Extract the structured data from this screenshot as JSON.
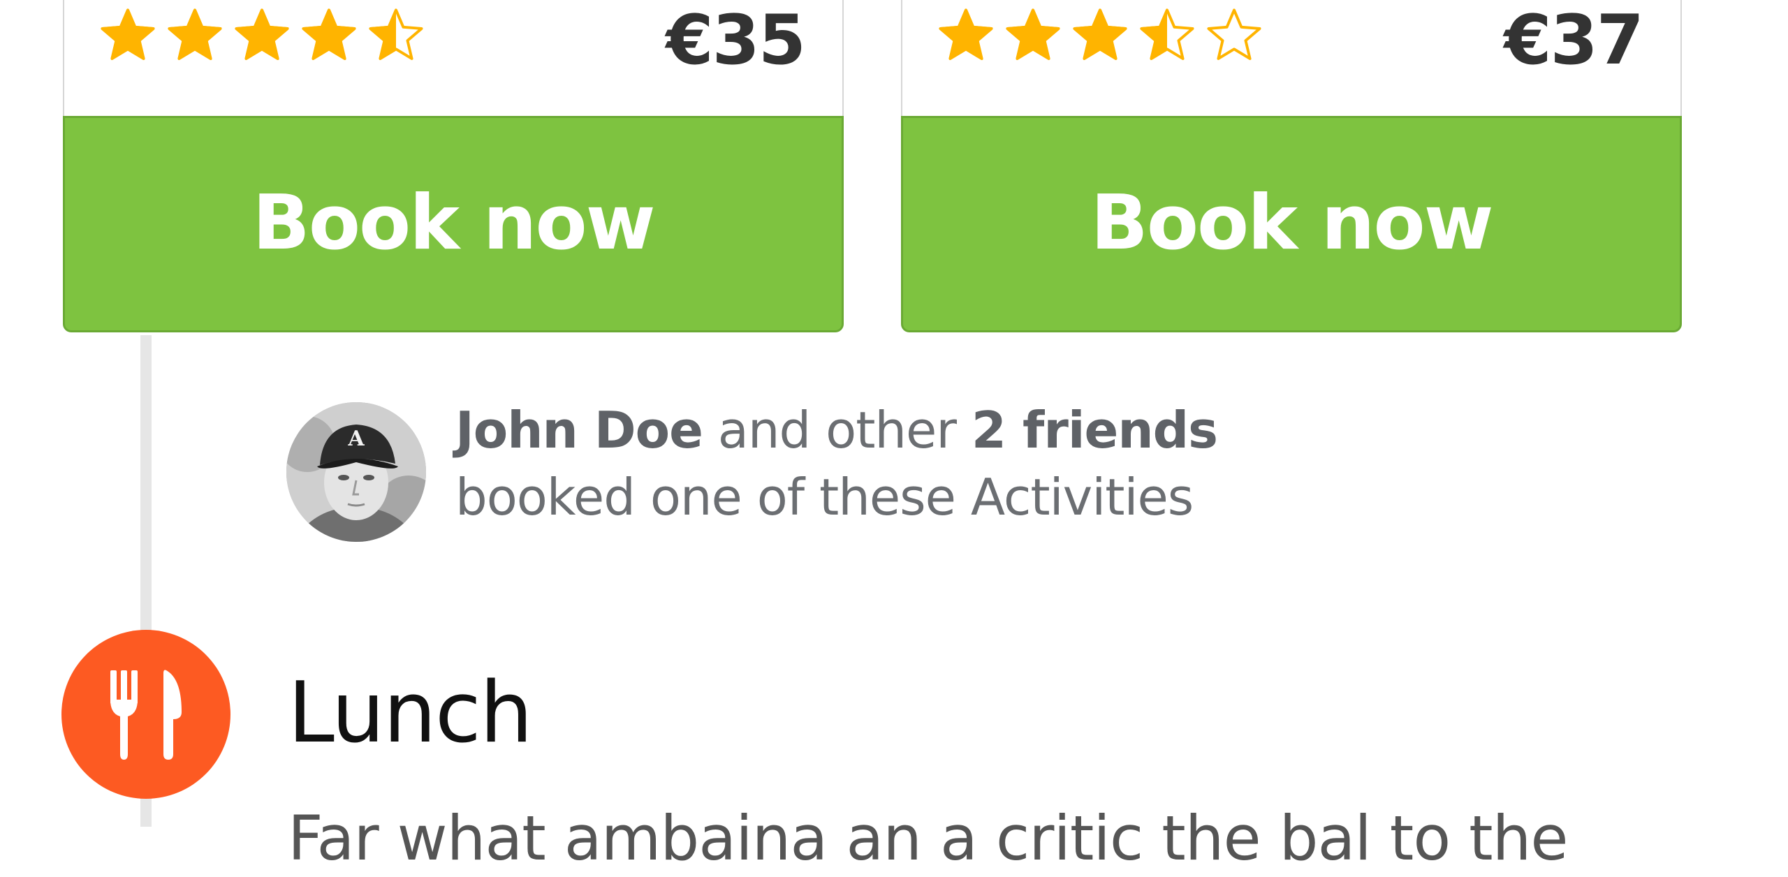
{
  "activities": [
    {
      "rating": 4.5,
      "rating_max": 5,
      "price": "€35",
      "book_label": "Book now"
    },
    {
      "rating": 3.5,
      "rating_max": 5,
      "price": "€37",
      "book_label": "Book now"
    }
  ],
  "social": {
    "friend_name": "John Doe",
    "and_other": " and other ",
    "friends_count": "2 friends",
    "booked_text": "booked one of these Activities"
  },
  "lunch": {
    "icon": "fork-knife-icon",
    "title": "Lunch",
    "description": "Far what ambaina an a critic the bal to the"
  },
  "colors": {
    "star": "#FFB400",
    "book_button": "#7EC340",
    "lunch_icon_bg": "#FD5A22",
    "price_text": "#333333",
    "social_text": "#6B6E72"
  }
}
